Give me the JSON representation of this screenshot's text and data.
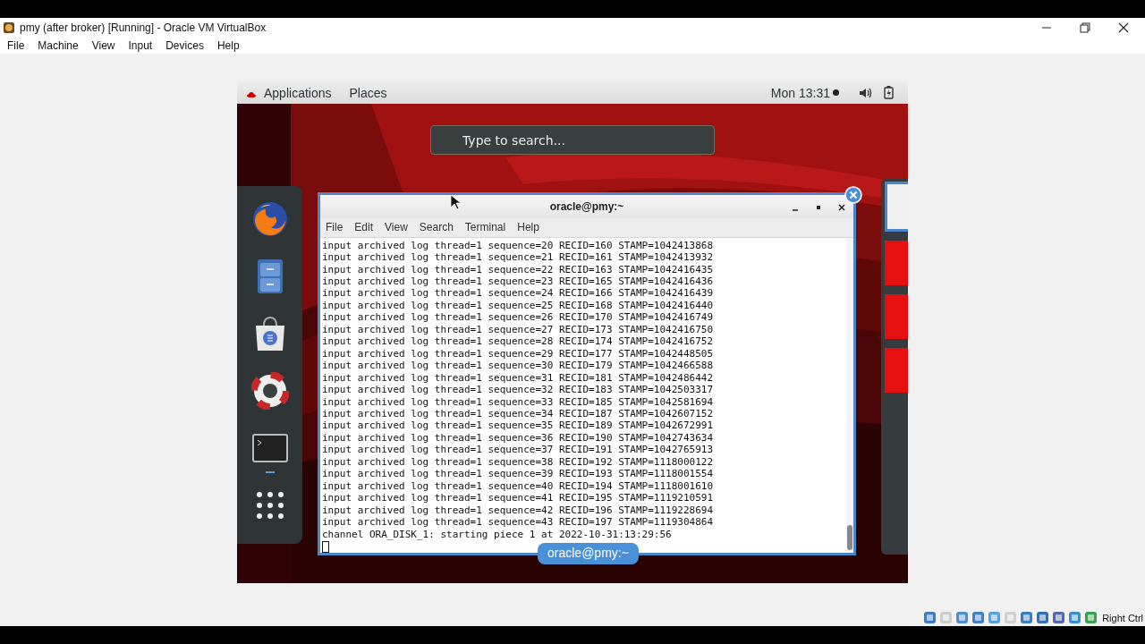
{
  "window": {
    "title": "pmy (after broker) [Running] - Oracle VM VirtualBox"
  },
  "menu": [
    "File",
    "Machine",
    "View",
    "Input",
    "Devices",
    "Help"
  ],
  "guest": {
    "top_bar": {
      "menus": [
        "Applications",
        "Places"
      ],
      "clock": "Mon 13:31"
    },
    "search": {
      "placeholder": "Type to search..."
    },
    "dock": [
      {
        "kind": "browser",
        "running": false
      },
      {
        "kind": "files",
        "running": false
      },
      {
        "kind": "software",
        "running": false
      },
      {
        "kind": "help",
        "running": false
      },
      {
        "kind": "terminal",
        "running": true
      },
      {
        "kind": "apps",
        "running": false
      }
    ],
    "terminal": {
      "title": "oracle@pmy:~",
      "menus": [
        "File",
        "Edit",
        "View",
        "Search",
        "Terminal",
        "Help"
      ],
      "lines": [
        "input archived log thread=1 sequence=20 RECID=160 STAMP=1042413868",
        "input archived log thread=1 sequence=21 RECID=161 STAMP=1042413932",
        "input archived log thread=1 sequence=22 RECID=163 STAMP=1042416435",
        "input archived log thread=1 sequence=23 RECID=165 STAMP=1042416436",
        "input archived log thread=1 sequence=24 RECID=166 STAMP=1042416439",
        "input archived log thread=1 sequence=25 RECID=168 STAMP=1042416440",
        "input archived log thread=1 sequence=26 RECID=170 STAMP=1042416749",
        "input archived log thread=1 sequence=27 RECID=173 STAMP=1042416750",
        "input archived log thread=1 sequence=28 RECID=174 STAMP=1042416752",
        "input archived log thread=1 sequence=29 RECID=177 STAMP=1042448505",
        "input archived log thread=1 sequence=30 RECID=179 STAMP=1042466588",
        "input archived log thread=1 sequence=31 RECID=181 STAMP=1042486442",
        "input archived log thread=1 sequence=32 RECID=183 STAMP=1042503317",
        "input archived log thread=1 sequence=33 RECID=185 STAMP=1042581694",
        "input archived log thread=1 sequence=34 RECID=187 STAMP=1042607152",
        "input archived log thread=1 sequence=35 RECID=189 STAMP=1042672991",
        "input archived log thread=1 sequence=36 RECID=190 STAMP=1042743634",
        "input archived log thread=1 sequence=37 RECID=191 STAMP=1042765913",
        "input archived log thread=1 sequence=38 RECID=192 STAMP=1118000122",
        "input archived log thread=1 sequence=39 RECID=193 STAMP=1118001554",
        "input archived log thread=1 sequence=40 RECID=194 STAMP=1118001610",
        "input archived log thread=1 sequence=41 RECID=195 STAMP=1119210591",
        "input archived log thread=1 sequence=42 RECID=196 STAMP=1119228694",
        "input archived log thread=1 sequence=43 RECID=197 STAMP=1119304864",
        "channel ORA_DISK_1: starting piece 1 at 2022-10-31:13:29:56"
      ],
      "window_label": "oracle@pmy:~"
    },
    "workspaces": [
      {
        "selected": true
      },
      {
        "selected": false
      },
      {
        "selected": false
      },
      {
        "selected": false
      }
    ]
  },
  "status_bar": {
    "host_key": "Right Ctrl"
  }
}
